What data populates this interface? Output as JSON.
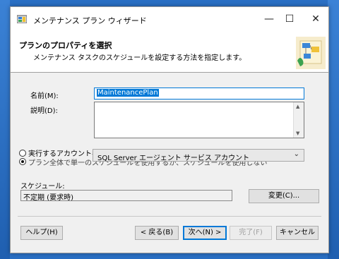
{
  "window": {
    "title": "メンテナンス プラン ウィザード",
    "minimize_glyph": "—",
    "maximize_glyph": "☐",
    "close_glyph": "✕"
  },
  "header": {
    "title": "プランのプロパティを選択",
    "subtitle": "メンテナンス タスクのスケジュールを設定する方法を指定します。"
  },
  "form": {
    "name_label": "名前(M):",
    "name_value": "MaintenancePlan",
    "description_label": "説明(D):",
    "description_value": "",
    "run_as_label": "実行するアカウント名(R):",
    "run_as_value": "SQL Server エージェント サービス アカウント",
    "radio_option_label": "プラン全体で単一のスケジュールを使用するか、スケジュールを使用しない",
    "schedule_label": "スケジュール:",
    "schedule_value": "不定期 (要求時)",
    "change_button": "変更(C)..."
  },
  "footer": {
    "help_button": "ヘルプ(H)",
    "back_button": "< 戻る(B)",
    "next_button": "次へ(N) >",
    "finish_button": "完了(F)",
    "cancel_button": "キャンセル"
  },
  "icons": {
    "app": "wizard-app-icon",
    "header": "maintenance-plan-graphic",
    "combo": "chevron-down-icon"
  },
  "colors": {
    "accent": "#0078d7",
    "desktop": "#2a6fc4"
  }
}
